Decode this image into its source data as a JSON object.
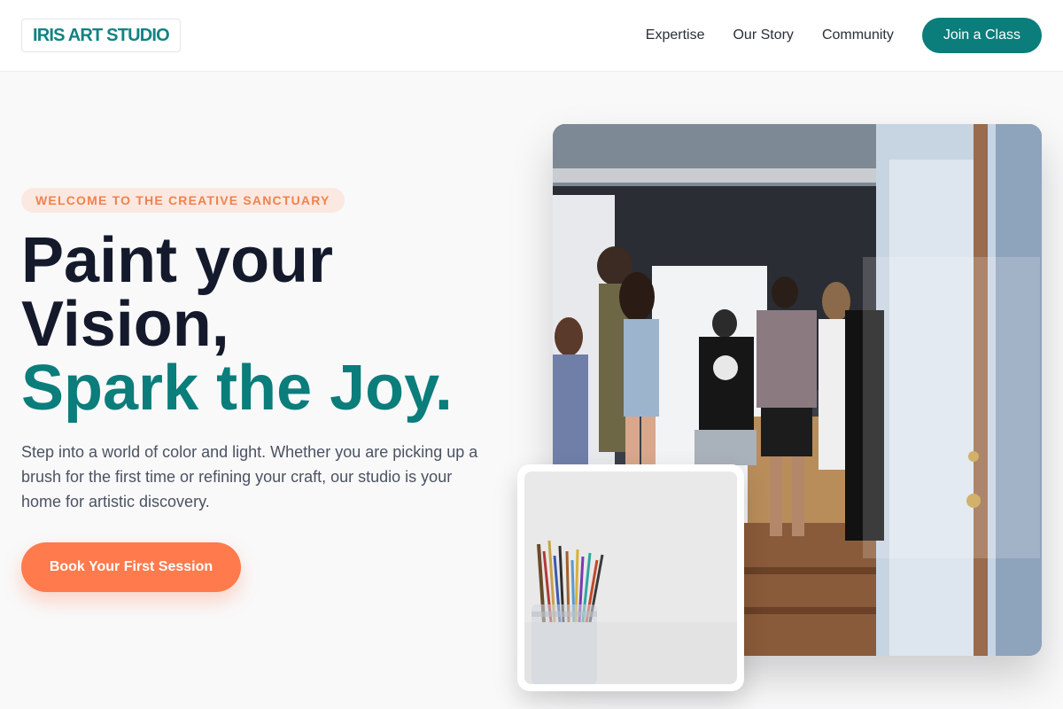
{
  "brand": {
    "name": "IRIS ART STUDIO"
  },
  "nav": {
    "links": [
      "Expertise",
      "Our Story",
      "Community"
    ],
    "cta_label": "Join a Class"
  },
  "hero": {
    "badge": "WELCOME TO THE CREATIVE SANCTUARY",
    "headline_line1": "Paint your Vision,",
    "headline_accent": "Spark the Joy.",
    "intro": "Step into a world of color and light. Whether you are picking up a brush for the first time or refining your craft, our studio is your home for artistic discovery.",
    "cta_label": "Book Your First Session"
  },
  "images": {
    "main": "gallery-visitors-photo",
    "secondary": "paintbrush-jar-photo"
  },
  "colors": {
    "teal": "#0b7d7b",
    "orange": "#ff7a4c",
    "badge_bg": "#fbe8e1",
    "heading": "#141a2b",
    "body_text": "#4b5262"
  }
}
